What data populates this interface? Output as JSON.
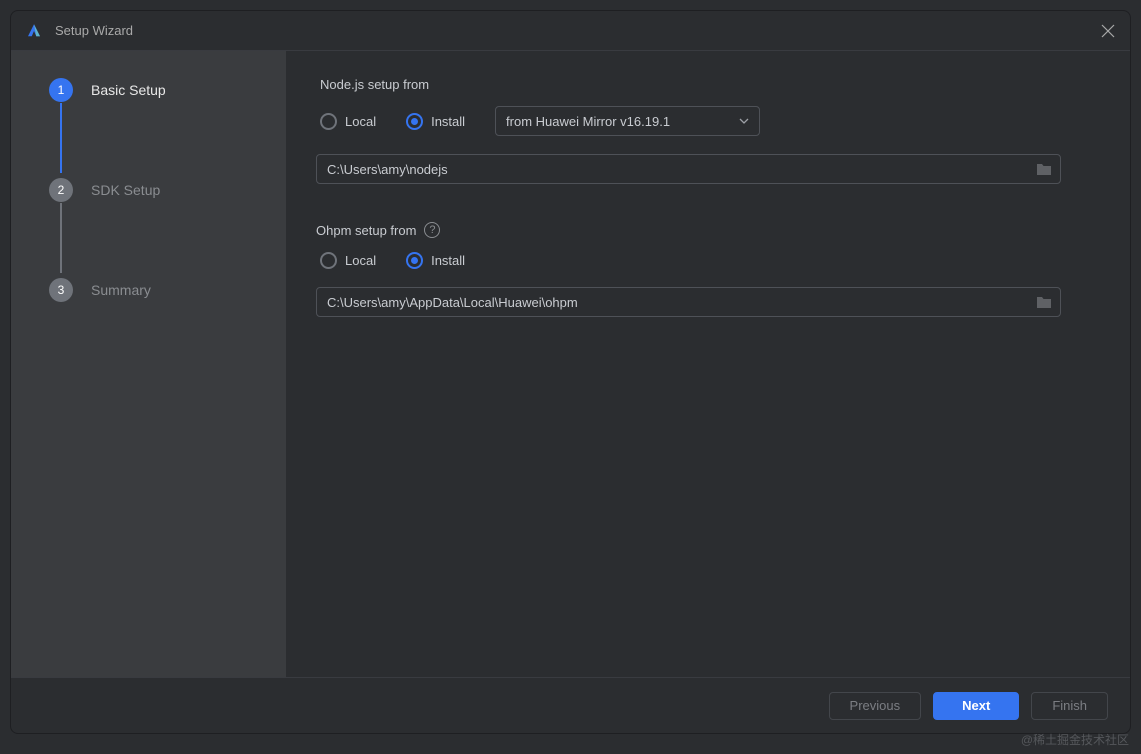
{
  "window": {
    "title": "Setup Wizard"
  },
  "sidebar": {
    "steps": [
      {
        "num": "1",
        "label": "Basic Setup"
      },
      {
        "num": "2",
        "label": "SDK Setup"
      },
      {
        "num": "3",
        "label": "Summary"
      }
    ]
  },
  "nodejs": {
    "title": "Node.js setup from",
    "local_label": "Local",
    "install_label": "Install",
    "select_value": "from Huawei Mirror v16.19.1",
    "path": "C:\\Users\\amy\\nodejs"
  },
  "ohpm": {
    "title": "Ohpm setup from",
    "local_label": "Local",
    "install_label": "Install",
    "path": "C:\\Users\\amy\\AppData\\Local\\Huawei\\ohpm"
  },
  "footer": {
    "previous": "Previous",
    "next": "Next",
    "finish": "Finish"
  },
  "watermark": "@稀土掘金技术社区"
}
